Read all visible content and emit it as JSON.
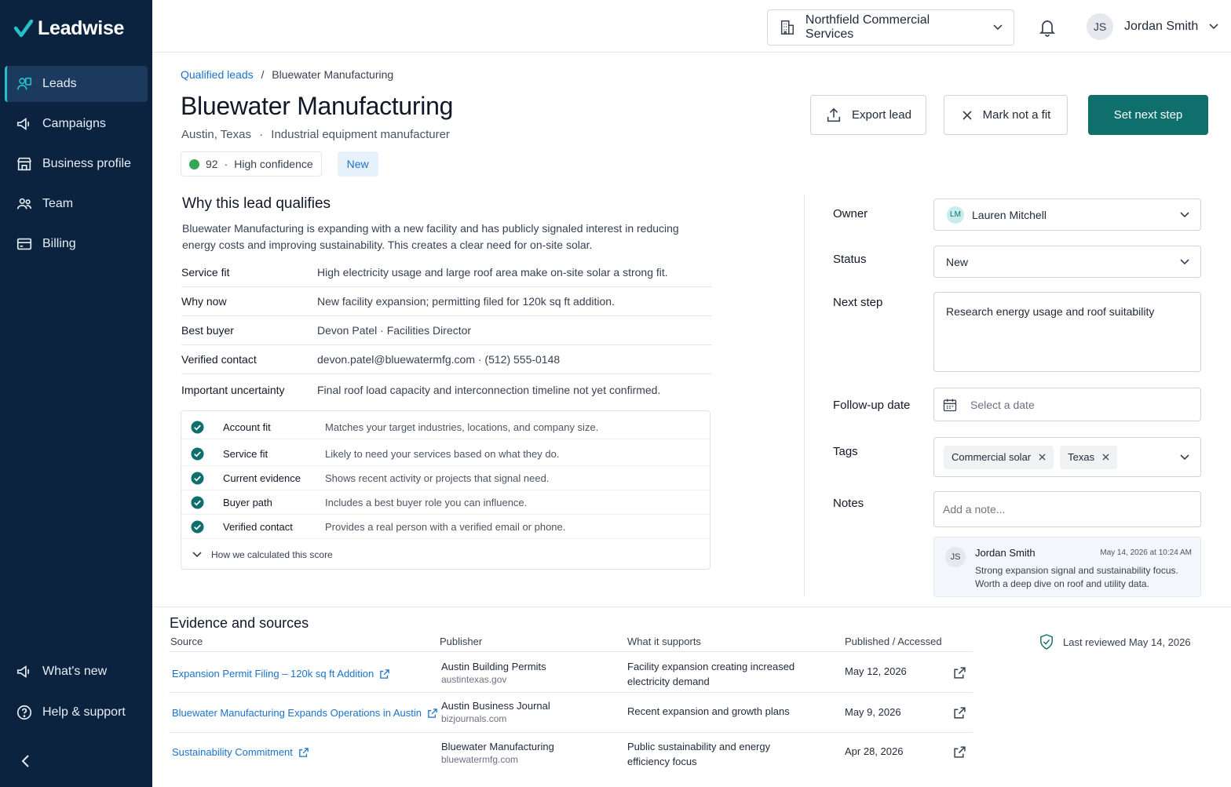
{
  "app": {
    "name": "Leadwise"
  },
  "sidebar": {
    "items": [
      {
        "label": "Leads",
        "icon": "leads-icon"
      },
      {
        "label": "Campaigns",
        "icon": "megaphone-icon"
      },
      {
        "label": "Business profile",
        "icon": "store-icon"
      },
      {
        "label": "Team",
        "icon": "team-icon"
      },
      {
        "label": "Billing",
        "icon": "card-icon"
      }
    ],
    "bottom": [
      {
        "label": "What's new",
        "icon": "megaphone-icon"
      },
      {
        "label": "Help & support",
        "icon": "help-icon"
      }
    ]
  },
  "topbar": {
    "org": "Northfield Commercial Services",
    "user_initials": "JS",
    "user_name": "Jordan Smith"
  },
  "breadcrumb": {
    "parent": "Qualified leads",
    "sep": "/",
    "current": "Bluewater Manufacturing"
  },
  "lead": {
    "title": "Bluewater Manufacturing",
    "location": "Austin, Texas",
    "dot": "·",
    "industry": "Industrial equipment manufacturer",
    "score": "92",
    "confidence": "High confidence",
    "status_badge": "New"
  },
  "actions": {
    "export": "Export lead",
    "not_fit": "Mark not a fit",
    "next_step": "Set next step"
  },
  "qualifies": {
    "title": "Why this lead qualifies",
    "desc": "Bluewater Manufacturing is  expanding with a new facility and has publicly signaled interest in reducing energy costs and improving sustainability. This creates a clear need for on-site solar.",
    "rows": [
      {
        "k": "Service fit",
        "v": "High electricity usage and large roof area make on-site solar a strong fit."
      },
      {
        "k": "Why now",
        "v": "New facility expansion; permitting filed for 120k sq ft addition."
      },
      {
        "k": "Best buyer",
        "v": "Devon Patel  ·  Facilities Director"
      },
      {
        "k": "Verified contact",
        "v": "devon.patel@bluewatermfg.com  ·  (512) 555-0148"
      },
      {
        "k": "Important uncertainty",
        "v": "Final roof load capacity and interconnection timeline not yet confirmed."
      }
    ],
    "checks": [
      {
        "k": "Account fit",
        "v": "Matches your target industries, locations, and company size."
      },
      {
        "k": "Service fit",
        "v": "Likely to need your services based on what they do."
      },
      {
        "k": "Current evidence",
        "v": "Shows recent activity or projects that signal need."
      },
      {
        "k": "Buyer path",
        "v": "Includes a best buyer role you can influence."
      },
      {
        "k": "Verified contact",
        "v": "Provides a real person with a verified email or phone."
      }
    ],
    "calc_label": "How we calculated this score"
  },
  "form": {
    "owner_label": "Owner",
    "owner_initials": "LM",
    "owner_value": "Lauren Mitchell",
    "status_label": "Status",
    "status_value": "New",
    "next_label": "Next step",
    "next_value": "Research energy usage and roof suitability",
    "follow_label": "Follow-up date",
    "follow_placeholder": "Select a date",
    "tags_label": "Tags",
    "tags": [
      "Commercial solar",
      "Texas"
    ],
    "notes_label": "Notes",
    "notes_placeholder": "Add a note...",
    "note": {
      "initials": "JS",
      "author": "Jordan Smith",
      "date": "May 14, 2026 at 10:24 AM",
      "text": "Strong expansion signal and sustainability focus. Worth a deep dive on roof and utility data."
    }
  },
  "evidence": {
    "title": "Evidence and sources",
    "headers": {
      "source": "Source",
      "publisher": "Publisher",
      "supports": "What it supports",
      "date": "Published / Accessed"
    },
    "rows": [
      {
        "source": "Expansion Permit Filing – 120k sq ft Addition",
        "publisher": "Austin Building Permits",
        "domain": "austintexas.gov",
        "supports": "Facility expansion creating increased electricity demand",
        "date": "May 12, 2026"
      },
      {
        "source": "Bluewater Manufacturing Expands Operations in Austin",
        "publisher": "Austin Business Journal",
        "domain": "bizjournals.com",
        "supports": "Recent expansion and growth plans",
        "date": "May 9, 2026"
      },
      {
        "source": "Sustainability Commitment",
        "publisher": "Bluewater Manufacturing",
        "domain": "bluewatermfg.com",
        "supports": "Public sustainability and energy efficiency focus",
        "date": "Apr 28, 2026"
      }
    ],
    "reviewed": "Last reviewed May 14, 2026"
  },
  "colors": {
    "sidebar": "#0c2340",
    "accent": "#26c0c7",
    "primary": "#0e6f6d",
    "link": "#1a73c9"
  }
}
